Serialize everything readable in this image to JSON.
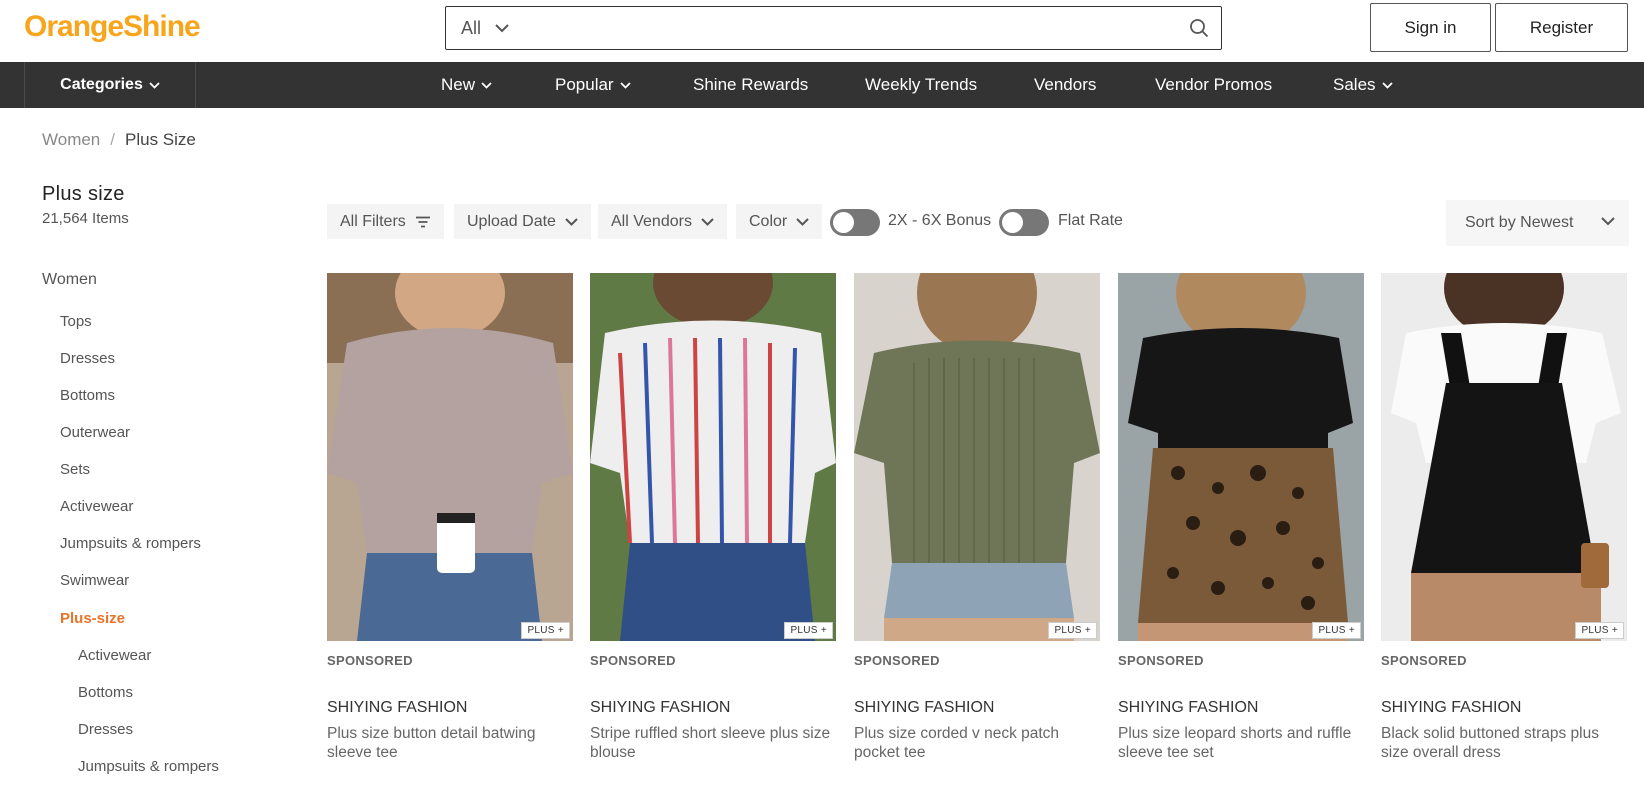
{
  "header": {
    "logo_part1": "Orange",
    "logo_part2": "Shine",
    "search": {
      "category": "All",
      "placeholder": ""
    },
    "signin_label": "Sign in",
    "register_label": "Register"
  },
  "nav": {
    "categories_label": "Categories",
    "items": [
      {
        "label": "New"
      },
      {
        "label": "Popular"
      },
      {
        "label": "Shine Rewards"
      },
      {
        "label": "Weekly Trends"
      },
      {
        "label": "Vendors"
      },
      {
        "label": "Vendor Promos"
      },
      {
        "label": "Sales"
      }
    ]
  },
  "breadcrumb": {
    "parent": "Women",
    "separator": "/",
    "current": "Plus Size"
  },
  "sidebar": {
    "title": "Plus size",
    "count": "21,564 Items",
    "items": [
      {
        "label": "Women"
      },
      {
        "label": "Tops"
      },
      {
        "label": "Dresses"
      },
      {
        "label": "Bottoms"
      },
      {
        "label": "Outerwear"
      },
      {
        "label": "Sets"
      },
      {
        "label": "Activewear"
      },
      {
        "label": "Jumpsuits & rompers"
      },
      {
        "label": "Swimwear"
      },
      {
        "label": "Plus-size"
      },
      {
        "label": "Activewear"
      },
      {
        "label": "Bottoms"
      },
      {
        "label": "Dresses"
      },
      {
        "label": "Jumpsuits & rompers"
      }
    ]
  },
  "filters": {
    "all_filters": "All Filters",
    "upload_date": "Upload Date",
    "all_vendors": "All Vendors",
    "color": "Color",
    "toggle1": "2X - 6X Bonus",
    "toggle2": "Flat Rate",
    "sort": "Sort by Newest"
  },
  "colors": {
    "brand_orange": "#f6a51c",
    "active_link": "#e8742a",
    "navbar": "#333333"
  },
  "products": [
    {
      "badge": "PLUS +",
      "sponsored": "SPONSORED",
      "vendor": "SHIYING FASHION",
      "name": "Plus size button detail batwing sleeve tee"
    },
    {
      "badge": "PLUS +",
      "sponsored": "SPONSORED",
      "vendor": "SHIYING FASHION",
      "name": "Stripe ruffled short sleeve plus size blouse"
    },
    {
      "badge": "PLUS +",
      "sponsored": "SPONSORED",
      "vendor": "SHIYING FASHION",
      "name": "Plus size corded v neck patch pocket tee"
    },
    {
      "badge": "PLUS +",
      "sponsored": "SPONSORED",
      "vendor": "SHIYING FASHION",
      "name": "Plus size leopard shorts and ruffle sleeve tee set"
    },
    {
      "badge": "PLUS +",
      "sponsored": "SPONSORED",
      "vendor": "SHIYING FASHION",
      "name": "Black solid buttoned straps plus size overall dress"
    }
  ]
}
